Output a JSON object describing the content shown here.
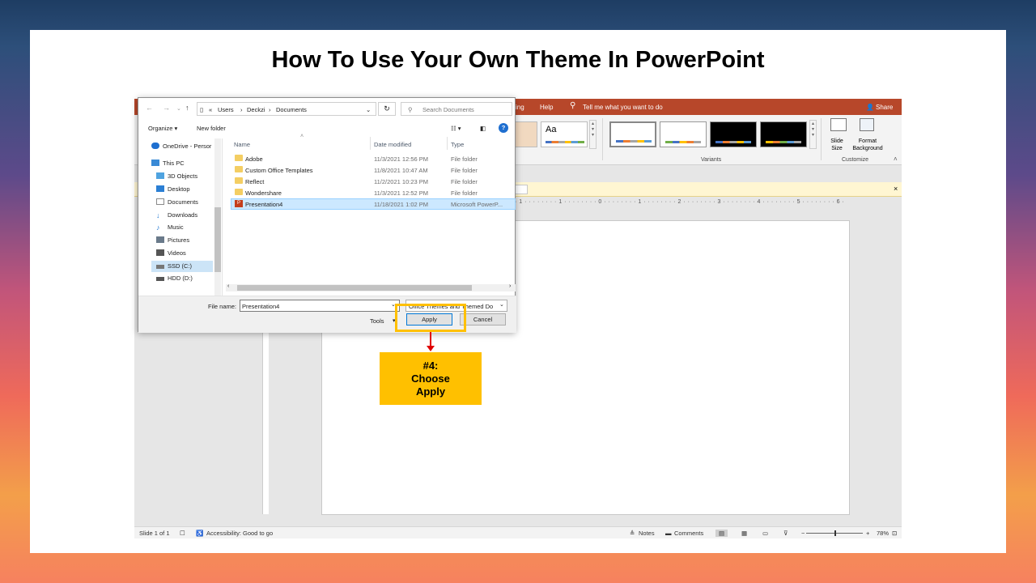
{
  "slide_title": "How To Use Your Own Theme In PowerPoint",
  "ppt": {
    "menu_partial": "ing",
    "help": "Help",
    "tell_me": "Tell me what you want to do",
    "share": "Share",
    "theme_sample": "Aa",
    "variants_label": "Variants",
    "customize_label": "Customize",
    "slide_size": "Slide Size",
    "format_background": "Format Background",
    "notice_partial": "e",
    "ruler": "· 1 · · · · · · · · 1 · · · · · · · · 0 · · · · · · · · 1 · · · · · · · · 2 · · · · · · · · 3 · · · · · · · · 4 · · · · · · · · 5 · · · · · · · · 6 ·",
    "status": {
      "slide_count": "Slide 1 of 1",
      "accessibility": "Accessibility: Good to go",
      "notes": "Notes",
      "comments": "Comments",
      "zoom": "78%"
    }
  },
  "dialog": {
    "breadcrumb": [
      "«",
      "Users",
      "›",
      "Deckzi",
      "›",
      "Documents"
    ],
    "search_placeholder": "Search Documents",
    "organize": "Organize ▾",
    "new_folder": "New folder",
    "sidebar": [
      {
        "label": "OneDrive - Persor",
        "icon": "cloud-icon",
        "color": "#1e6fd0"
      },
      {
        "label": "This PC",
        "icon": "pc-icon",
        "color": "#3a8ad6"
      },
      {
        "label": "3D Objects",
        "icon": "cube-icon",
        "color": "#4fa3e0"
      },
      {
        "label": "Desktop",
        "icon": "desktop-icon",
        "color": "#2b7fd4"
      },
      {
        "label": "Documents",
        "icon": "document-icon",
        "color": "#8a8a8a"
      },
      {
        "label": "Downloads",
        "icon": "download-icon",
        "color": "#2b7fd4"
      },
      {
        "label": "Music",
        "icon": "music-icon",
        "color": "#2b7fd4"
      },
      {
        "label": "Pictures",
        "icon": "picture-icon",
        "color": "#6a7a8a"
      },
      {
        "label": "Videos",
        "icon": "video-icon",
        "color": "#555"
      },
      {
        "label": "SSD (C:)",
        "icon": "drive-icon",
        "color": "#777"
      },
      {
        "label": "HDD (D:)",
        "icon": "drive-icon",
        "color": "#555"
      }
    ],
    "columns": {
      "name": "Name",
      "date": "Date modified",
      "type": "Type"
    },
    "files": [
      {
        "name": "Adobe",
        "date": "11/3/2021 12:56 PM",
        "type": "File folder"
      },
      {
        "name": "Custom Office Templates",
        "date": "11/8/2021 10:47 AM",
        "type": "File folder"
      },
      {
        "name": "Reflect",
        "date": "11/2/2021 10:23 PM",
        "type": "File folder"
      },
      {
        "name": "Wondershare",
        "date": "11/3/2021 12:52 PM",
        "type": "File folder"
      },
      {
        "name": "Presentation4",
        "date": "11/18/2021 1:02 PM",
        "type": "Microsoft PowerP..."
      }
    ],
    "file_name_label": "File name:",
    "file_name_value": "Presentation4",
    "file_type": "Office Themes and Themed Do",
    "tools": "Tools",
    "apply": "Apply",
    "cancel": "Cancel"
  },
  "callout": "#4: Choose Apply"
}
